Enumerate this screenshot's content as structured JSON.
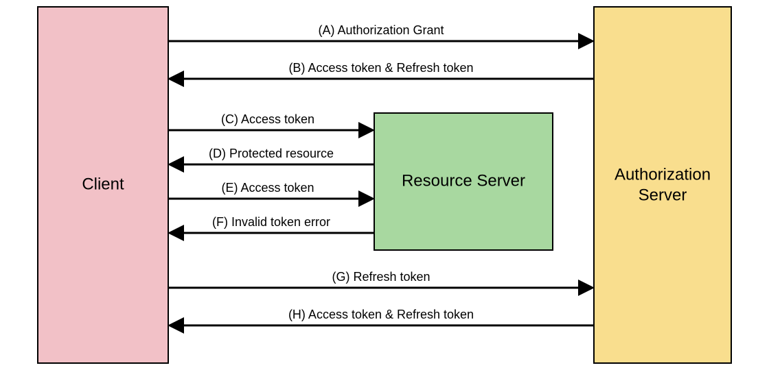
{
  "nodes": {
    "client": {
      "label": "Client",
      "fill": "#f2c1c7"
    },
    "resource_server": {
      "label": "Resource Server",
      "fill": "#a8d8a0"
    },
    "auth_server_line1": "Authorization",
    "auth_server_line2": "Server",
    "auth_server_fill": "#f9de8e"
  },
  "flows": {
    "a": "(A) Authorization Grant",
    "b": "(B) Access token & Refresh token",
    "c": "(C) Access token",
    "d": "(D) Protected resource",
    "e": "(E) Access token",
    "f": "(F) Invalid token error",
    "g": "(G) Refresh token",
    "h": "(H) Access token & Refresh token"
  }
}
